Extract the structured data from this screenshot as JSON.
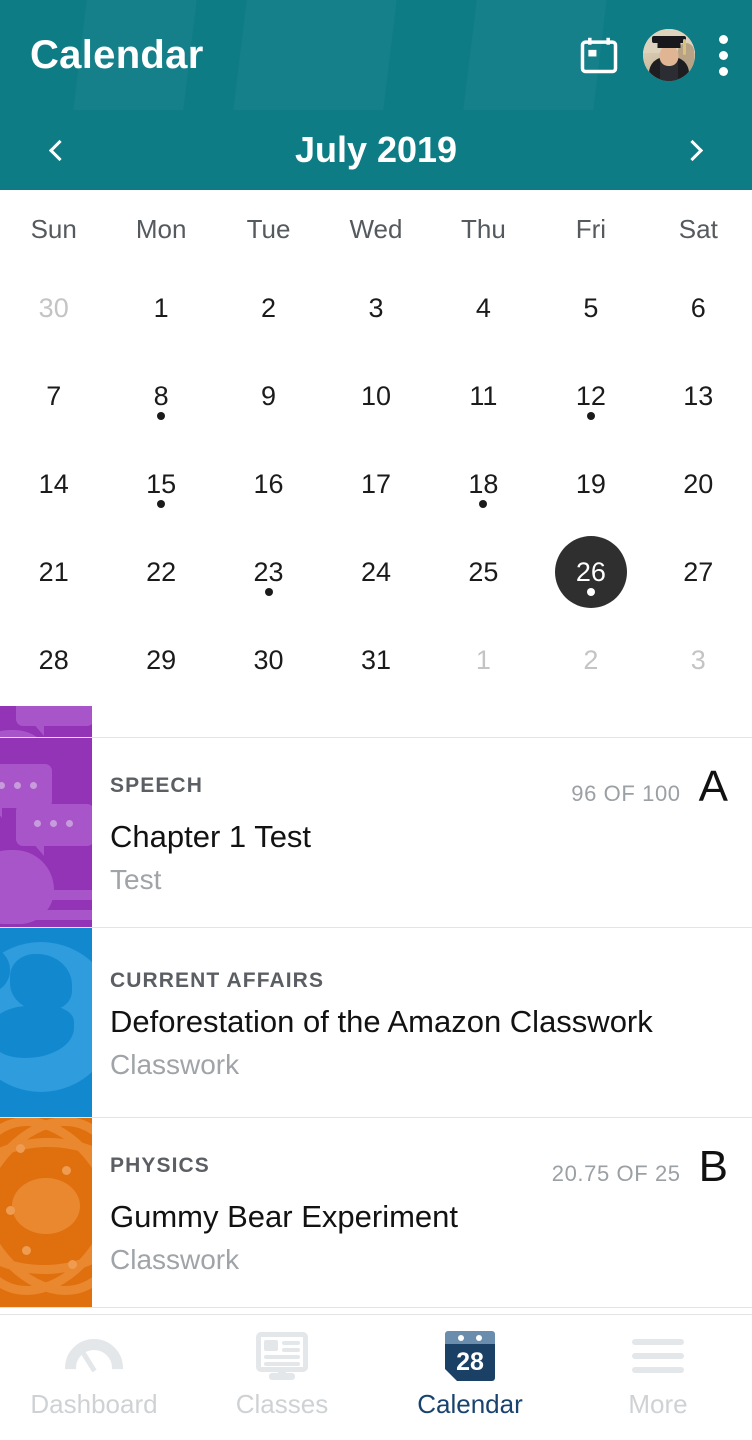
{
  "theme": {
    "teal": "#0d7c85",
    "selected_day_bg": "#2f2f2f",
    "active_nav_color": "#19436e",
    "muted_text": "#c4c4c4"
  },
  "appbar": {
    "title": "Calendar",
    "calendar_icon": "calendar-icon",
    "avatar_icon": "user-avatar",
    "overflow_icon": "kebab-menu-icon"
  },
  "monthbar": {
    "prev_label": "‹",
    "month_title": "July 2019",
    "next_label": "›"
  },
  "calendar": {
    "weekdays": [
      "Sun",
      "Mon",
      "Tue",
      "Wed",
      "Thu",
      "Fri",
      "Sat"
    ],
    "weeks": [
      [
        {
          "day": "30",
          "muted": true,
          "dot": false,
          "selected": false
        },
        {
          "day": "1",
          "muted": false,
          "dot": false,
          "selected": false
        },
        {
          "day": "2",
          "muted": false,
          "dot": false,
          "selected": false
        },
        {
          "day": "3",
          "muted": false,
          "dot": false,
          "selected": false
        },
        {
          "day": "4",
          "muted": false,
          "dot": false,
          "selected": false
        },
        {
          "day": "5",
          "muted": false,
          "dot": false,
          "selected": false
        },
        {
          "day": "6",
          "muted": false,
          "dot": false,
          "selected": false
        }
      ],
      [
        {
          "day": "7",
          "muted": false,
          "dot": false,
          "selected": false
        },
        {
          "day": "8",
          "muted": false,
          "dot": true,
          "selected": false
        },
        {
          "day": "9",
          "muted": false,
          "dot": false,
          "selected": false
        },
        {
          "day": "10",
          "muted": false,
          "dot": false,
          "selected": false
        },
        {
          "day": "11",
          "muted": false,
          "dot": false,
          "selected": false
        },
        {
          "day": "12",
          "muted": false,
          "dot": true,
          "selected": false
        },
        {
          "day": "13",
          "muted": false,
          "dot": false,
          "selected": false
        }
      ],
      [
        {
          "day": "14",
          "muted": false,
          "dot": false,
          "selected": false
        },
        {
          "day": "15",
          "muted": false,
          "dot": true,
          "selected": false
        },
        {
          "day": "16",
          "muted": false,
          "dot": false,
          "selected": false
        },
        {
          "day": "17",
          "muted": false,
          "dot": false,
          "selected": false
        },
        {
          "day": "18",
          "muted": false,
          "dot": true,
          "selected": false
        },
        {
          "day": "19",
          "muted": false,
          "dot": false,
          "selected": false
        },
        {
          "day": "20",
          "muted": false,
          "dot": false,
          "selected": false
        }
      ],
      [
        {
          "day": "21",
          "muted": false,
          "dot": false,
          "selected": false
        },
        {
          "day": "22",
          "muted": false,
          "dot": false,
          "selected": false
        },
        {
          "day": "23",
          "muted": false,
          "dot": true,
          "selected": false
        },
        {
          "day": "24",
          "muted": false,
          "dot": false,
          "selected": false
        },
        {
          "day": "25",
          "muted": false,
          "dot": false,
          "selected": false
        },
        {
          "day": "26",
          "muted": false,
          "dot": true,
          "selected": true
        },
        {
          "day": "27",
          "muted": false,
          "dot": false,
          "selected": false
        }
      ],
      [
        {
          "day": "28",
          "muted": false,
          "dot": false,
          "selected": false
        },
        {
          "day": "29",
          "muted": false,
          "dot": false,
          "selected": false
        },
        {
          "day": "30",
          "muted": false,
          "dot": false,
          "selected": false
        },
        {
          "day": "31",
          "muted": false,
          "dot": false,
          "selected": false
        },
        {
          "day": "1",
          "muted": true,
          "dot": false,
          "selected": false
        },
        {
          "day": "2",
          "muted": true,
          "dot": false,
          "selected": false
        },
        {
          "day": "3",
          "muted": true,
          "dot": false,
          "selected": false
        }
      ]
    ]
  },
  "events": [
    {
      "course": "SPEECH",
      "title": "Chapter 1 Test",
      "subtitle": "Test",
      "score": "96 OF 100",
      "grade": "A",
      "thumb_color": "#9333b5",
      "thumb_icon": "speech-bubbles-thumbnail"
    },
    {
      "course": "CURRENT AFFAIRS",
      "title": "Deforestation of the Amazon Classwork",
      "subtitle": "Classwork",
      "score": "",
      "grade": "",
      "thumb_color": "#1288cf",
      "thumb_icon": "globe-thumbnail"
    },
    {
      "course": "PHYSICS",
      "title": "Gummy Bear Experiment",
      "subtitle": "Classwork",
      "score": "20.75 OF 25",
      "grade": "B",
      "thumb_color": "#e0700d",
      "thumb_icon": "atom-thumbnail"
    }
  ],
  "bottomnav": {
    "items": [
      {
        "label": "Dashboard",
        "icon": "gauge-icon",
        "active": false
      },
      {
        "label": "Classes",
        "icon": "monitor-icon",
        "active": false
      },
      {
        "label": "Calendar",
        "icon": "calendar-28-icon",
        "active": true
      },
      {
        "label": "More",
        "icon": "hamburger-icon",
        "active": false
      }
    ],
    "calendar_icon_day": "28"
  }
}
